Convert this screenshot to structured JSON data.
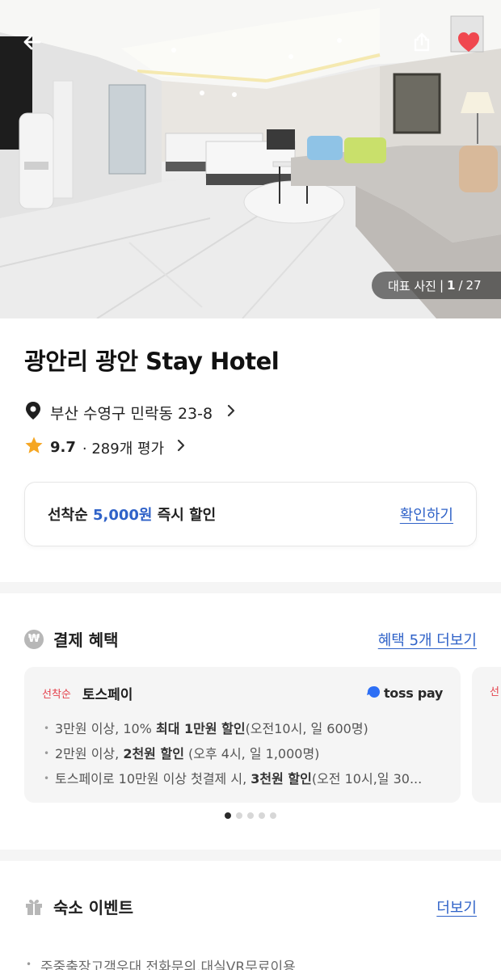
{
  "hero": {
    "photo_label": "대표 사진",
    "photo_current": "1",
    "photo_total": "27"
  },
  "hotel": {
    "name": "광안리 광안 Stay Hotel",
    "address": "부산 수영구 민락동 23-8",
    "rating": "9.7",
    "review_count": "· 289개 평가"
  },
  "coupon": {
    "prefix": "선착순 ",
    "amount": "5,000원",
    "suffix": " 즉시 할인",
    "link": "확인하기"
  },
  "payment_benefits": {
    "icon_text": "₩",
    "title": "결제 혜택",
    "more_link": "혜택 5개 더보기",
    "card": {
      "badge": "선착순",
      "name": "토스페이",
      "logo_text": "toss pay",
      "items": [
        {
          "a": "3만원 이상, 10% ",
          "b": "최대 1만원 할인",
          "c": "(오전10시, 일 600명)"
        },
        {
          "a": "2만원 이상, ",
          "b": "2천원 할인",
          "c": " (오후 4시, 일 1,000명)"
        },
        {
          "a": "토스페이로 10만원 이상 첫결제 시, ",
          "b": "3천원 할인",
          "c": "(오전 10시,일 30..."
        }
      ]
    },
    "peek_badge": "선"
  },
  "events": {
    "title": "숙소 이벤트",
    "more_link": "더보기",
    "items": [
      "주중출장고객우대 전화문의,대실VR무료이용"
    ]
  },
  "colors": {
    "accent": "#2f62c8",
    "heart": "#f0474f",
    "badge_red": "#e4404b",
    "toss_blue": "#2d6ff5"
  }
}
